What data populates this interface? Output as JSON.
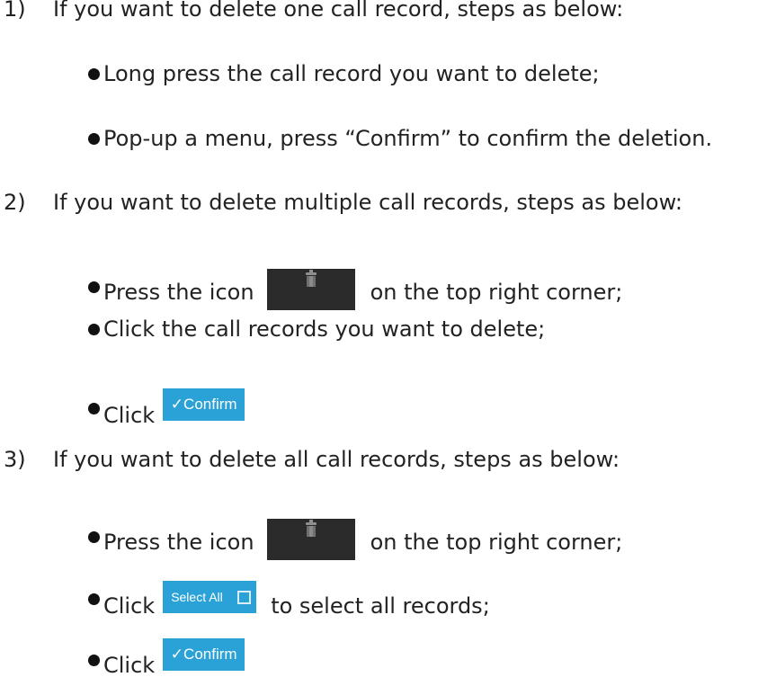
{
  "sections": [
    {
      "number": "1)",
      "heading": "If you want to delete one call record, steps as below:",
      "steps": [
        {
          "text": "Long press the call record you want to delete;"
        },
        {
          "text": "Pop-up a menu, press “Confirm” to confirm the deletion."
        }
      ]
    },
    {
      "number": "2)",
      "heading": "If you want to delete multiple call records, steps as below:",
      "steps": [
        {
          "before": "Press the icon",
          "icon": "trash-icon",
          "after": "on the top right corner;"
        },
        {
          "text": "Click the call records you want to delete;"
        },
        {
          "before": "Click",
          "button": "✓Confirm"
        }
      ]
    },
    {
      "number": "3)",
      "heading": "If you want to delete all call records, steps as below:",
      "steps": [
        {
          "before": "Press the icon",
          "icon": "trash-icon",
          "after": "on the top right corner;"
        },
        {
          "before": "Click",
          "button": "Select All",
          "after": "to select all records;"
        },
        {
          "before": "Click",
          "button": "✓Confirm"
        }
      ]
    }
  ],
  "colors": {
    "button_blue": "#2aa2d8",
    "icon_dark": "#2b2b2b"
  }
}
